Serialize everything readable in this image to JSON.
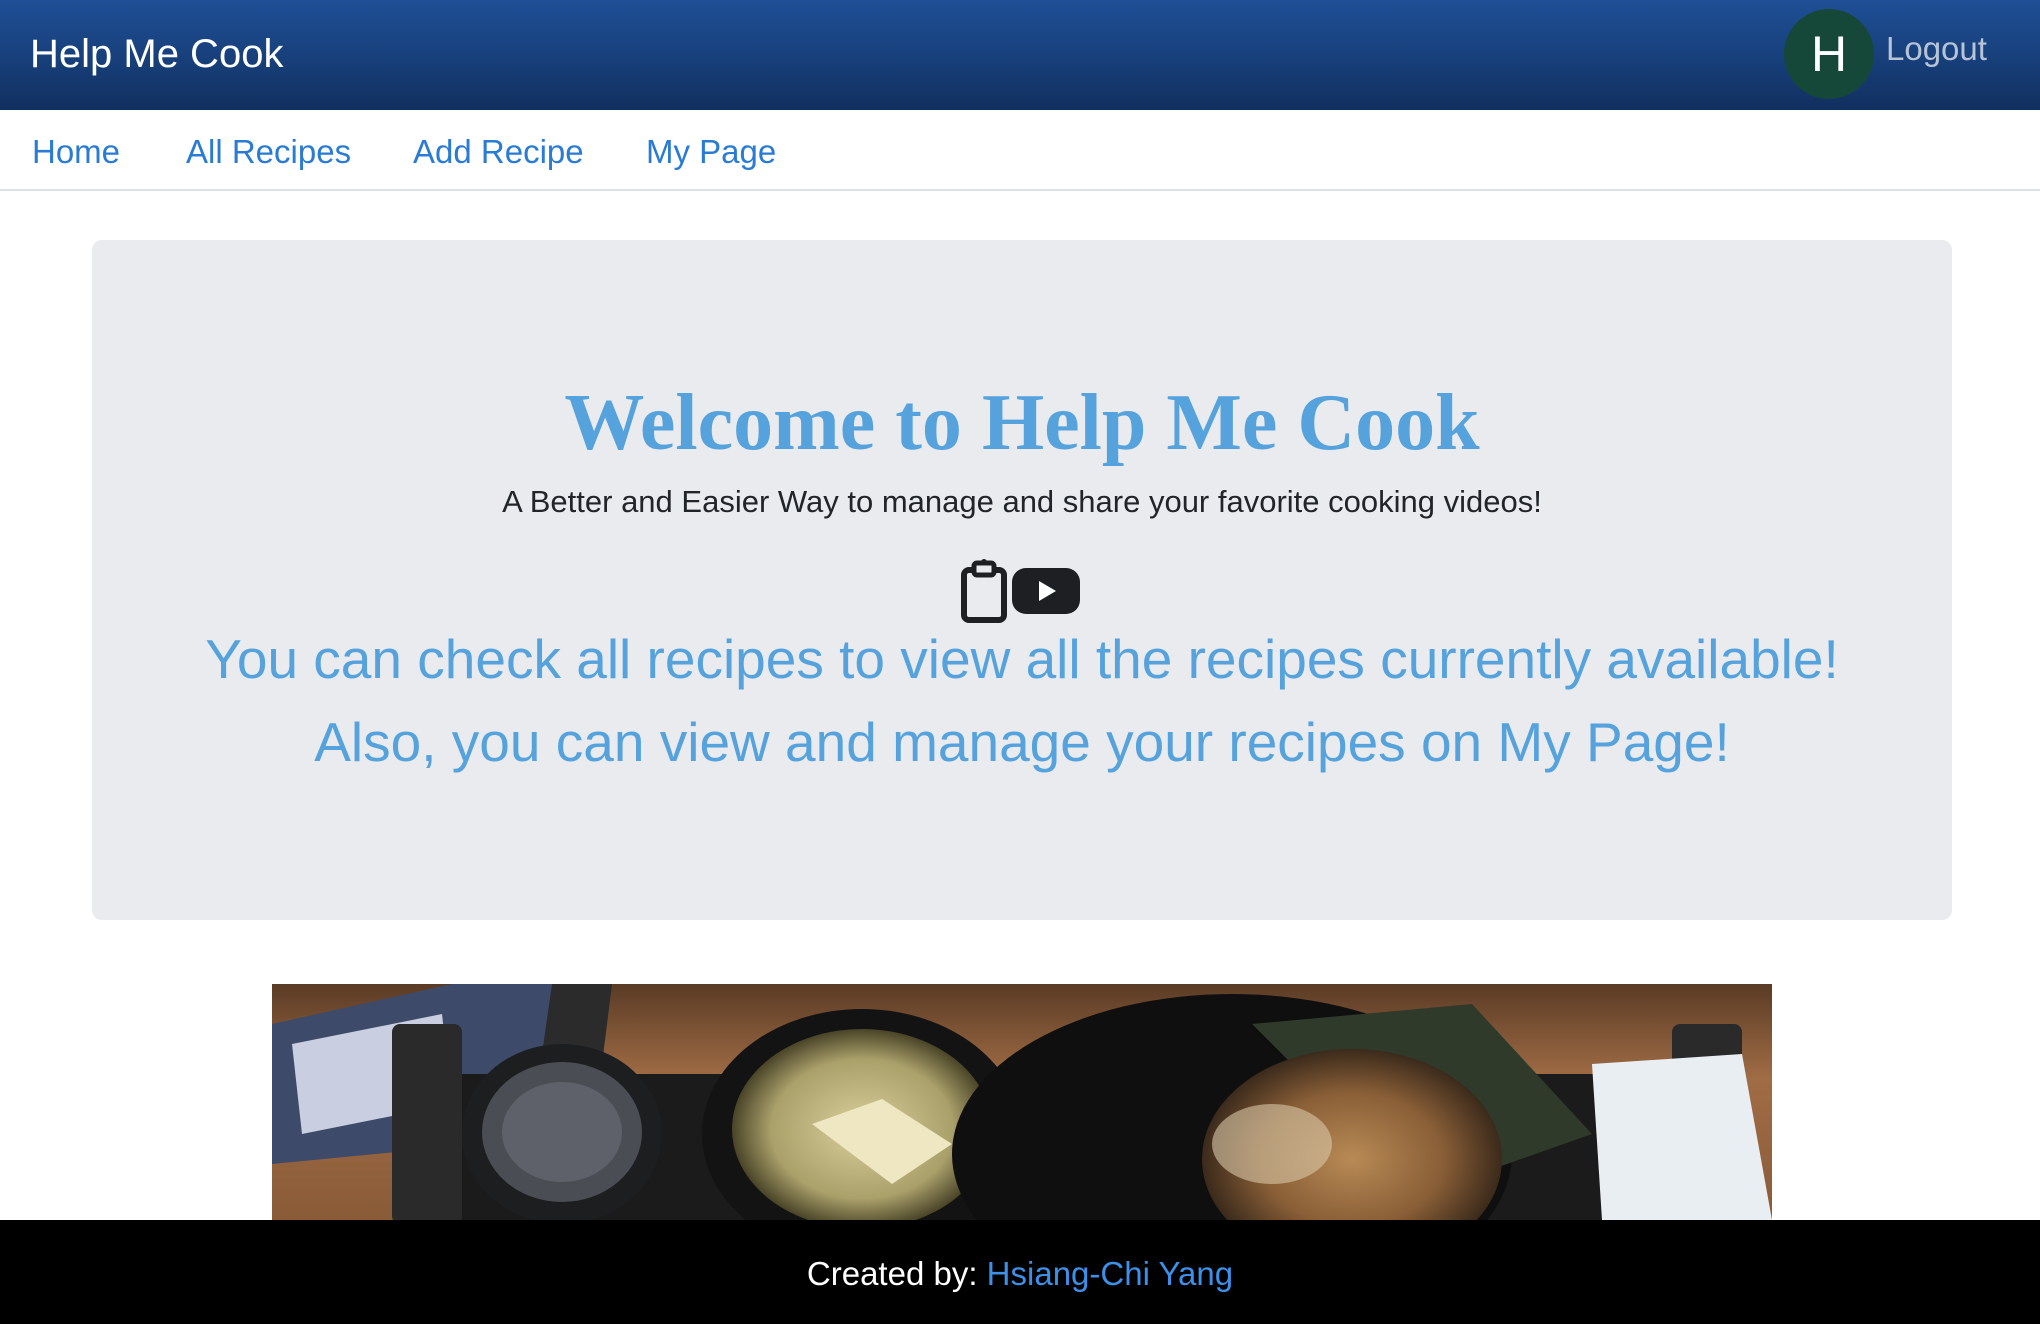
{
  "header": {
    "brand": "Help Me Cook",
    "avatar_initial": "H",
    "logout_label": "Logout"
  },
  "nav": {
    "items": [
      {
        "label": "Home"
      },
      {
        "label": "All Recipes"
      },
      {
        "label": "Add Recipe"
      },
      {
        "label": "My Page"
      }
    ]
  },
  "hero": {
    "welcome_prefix": "Welcome to",
    "welcome_brand": "Help Me Cook",
    "tagline": "A Better and Easier Way to manage and share your favorite cooking videos!",
    "icons": [
      "clipboard-icon",
      "youtube-play-icon"
    ],
    "line1": "You can check all recipes to view all the recipes currently available!",
    "line2": "Also, you can view and manage your recipes on My Page!"
  },
  "banner_image": {
    "subject": "ramen-meal-photo"
  },
  "footer": {
    "prefix": "Created by:",
    "author": "Hsiang-Chi Yang"
  },
  "colors": {
    "header_bg": "#173f7a",
    "nav_link": "#2a7bd3",
    "hero_text": "#55a2dd",
    "hero_bg": "#e9ebee",
    "avatar_bg": "#16483a",
    "footer_bg": "#000000",
    "footer_link": "#3d8fe8"
  }
}
